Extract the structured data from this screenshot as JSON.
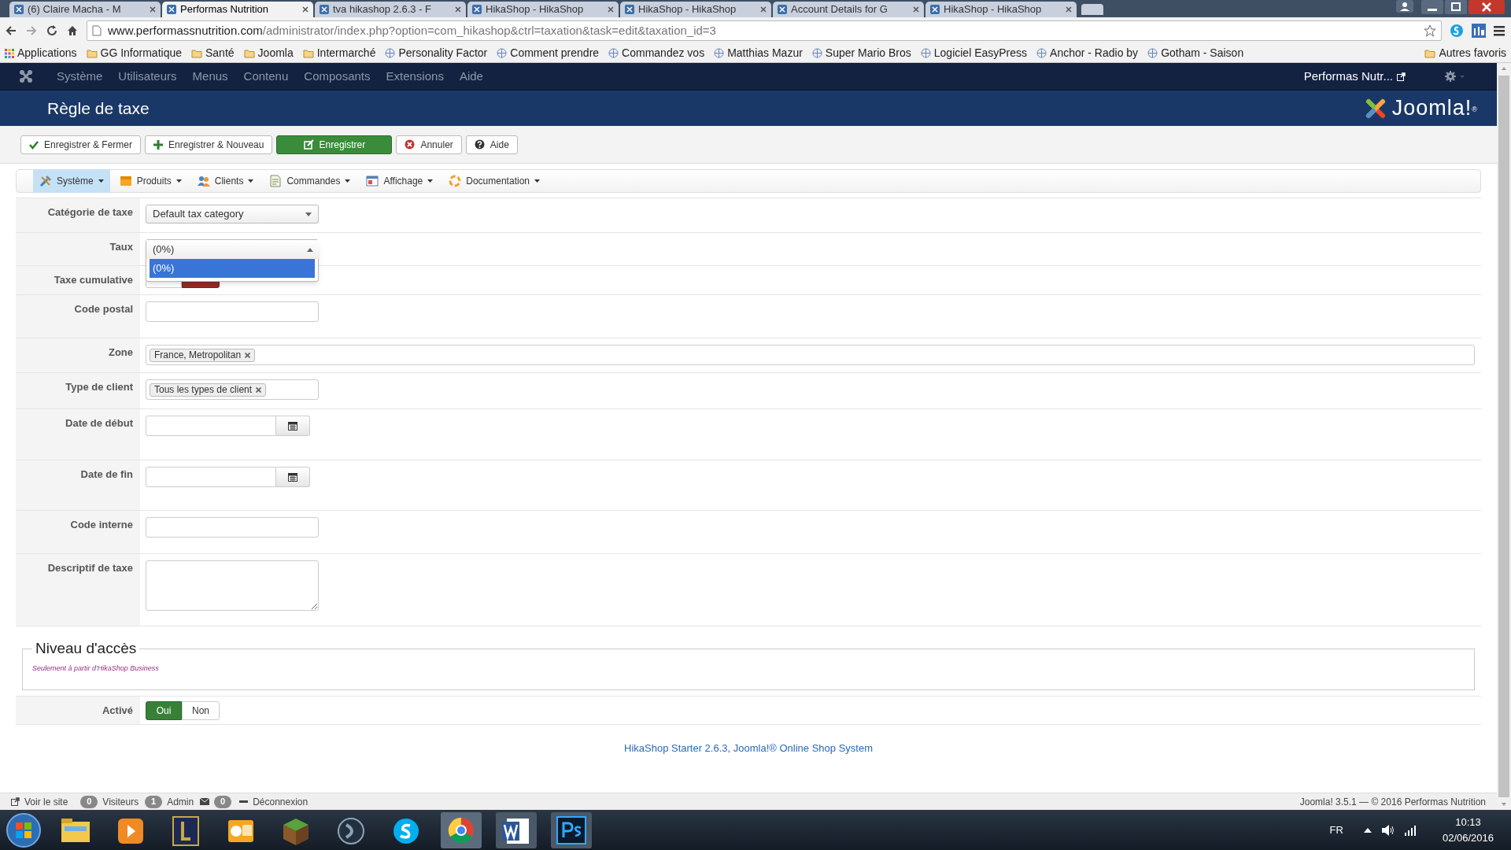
{
  "browser": {
    "tabs": [
      {
        "label": "(6) Claire Macha - M",
        "selected": false
      },
      {
        "label": "Performas Nutrition",
        "selected": true
      },
      {
        "label": "tva hikashop 2.6.3 - F",
        "selected": false
      },
      {
        "label": "HikaShop - HikaShop",
        "selected": false
      },
      {
        "label": "HikaShop - HikaShop",
        "selected": false
      },
      {
        "label": "Account Details for G",
        "selected": false
      },
      {
        "label": "HikaShop - HikaShop",
        "selected": false
      }
    ],
    "url_host": "www.performassnutrition.com",
    "url_path": "/administrator/index.php?option=com_hikashop&ctrl=taxation&task=edit&taxation_id=3",
    "bookmarks": [
      {
        "label": "Applications",
        "kind": "apps"
      },
      {
        "label": "GG Informatique",
        "kind": "folder"
      },
      {
        "label": "Santé",
        "kind": "folder"
      },
      {
        "label": "Joomla",
        "kind": "folder"
      },
      {
        "label": "Intermarché",
        "kind": "folder"
      },
      {
        "label": "Personality Factor",
        "kind": "site"
      },
      {
        "label": "Comment prendre",
        "kind": "site"
      },
      {
        "label": "Commandez vos",
        "kind": "site"
      },
      {
        "label": "Matthias Mazur",
        "kind": "site"
      },
      {
        "label": "Super Mario Bros",
        "kind": "site"
      },
      {
        "label": "Logiciel EasyPress",
        "kind": "site"
      },
      {
        "label": "Anchor - Radio by",
        "kind": "site"
      },
      {
        "label": "Gotham - Saison",
        "kind": "site"
      }
    ],
    "other_bookmarks": "Autres favoris"
  },
  "admin_menu": {
    "items": [
      "Système",
      "Utilisateurs",
      "Menus",
      "Contenu",
      "Composants",
      "Extensions",
      "Aide"
    ],
    "site_link": "Performas Nutr..."
  },
  "page": {
    "title": "Règle de taxe",
    "logo_text": "Joomla!$^{®}$"
  },
  "toolbar": [
    {
      "label": "Enregistrer & Fermer",
      "kind": "check",
      "primary": false
    },
    {
      "label": "Enregistrer & Nouveau",
      "kind": "plus",
      "primary": false
    },
    {
      "label": "Enregistrer",
      "kind": "edit",
      "primary": true
    },
    {
      "label": "Annuler",
      "kind": "cancel",
      "primary": false
    },
    {
      "label": "Aide",
      "kind": "help",
      "primary": false
    }
  ],
  "submenu": [
    {
      "label": "Système",
      "kind": "tools",
      "selected": true
    },
    {
      "label": "Produits",
      "kind": "box",
      "selected": false
    },
    {
      "label": "Clients",
      "kind": "users",
      "selected": false
    },
    {
      "label": "Commandes",
      "kind": "orders",
      "selected": false
    },
    {
      "label": "Affichage",
      "kind": "display",
      "selected": false
    },
    {
      "label": "Documentation",
      "kind": "docs",
      "selected": false
    }
  ],
  "form": [
    {
      "label": "Catégorie de taxe",
      "kind": "select",
      "value": "Default tax category"
    },
    {
      "label": "Taux",
      "kind": "select_open",
      "value": "(0%)",
      "options": [
        {
          "label": "(0%)",
          "selected": true
        }
      ]
    },
    {
      "label": "Taxe cumulative",
      "kind": "toggle",
      "options": [
        {
          "selected": false
        },
        {
          "selected": true
        }
      ]
    },
    {
      "label": "Code postal",
      "kind": "text"
    },
    {
      "label": "Zone",
      "kind": "tags",
      "wide": true,
      "tags": [
        "France, Metropolitan"
      ]
    },
    {
      "label": "Type de client",
      "kind": "tags",
      "wide": false,
      "tags": [
        "Tous les types de client"
      ]
    },
    {
      "label": "Date de début",
      "kind": "date"
    },
    {
      "label": "Date de fin",
      "kind": "date"
    },
    {
      "label": "Code interne",
      "kind": "text"
    },
    {
      "label": "Descriptif de taxe",
      "kind": "textarea"
    }
  ],
  "access": {
    "legend": "Niveau d'accès",
    "note": "Seulement à partir d'HikaShop Business"
  },
  "active": {
    "label": "Activé",
    "options": [
      {
        "label": "Oui",
        "selected": true
      },
      {
        "label": "Non",
        "selected": false
      }
    ]
  },
  "footer_link": "HikaShop Starter 2.6.3, Joomla!® Online Shop System",
  "status_bar": {
    "items": [
      {
        "kind": "link",
        "label": "Voir le site"
      },
      {
        "kind": "count",
        "count": "0",
        "label": "Visiteurs"
      },
      {
        "kind": "count",
        "count": "1",
        "label": "Admin"
      },
      {
        "kind": "mail",
        "count": "0"
      },
      {
        "kind": "logout",
        "label": "Déconnexion"
      }
    ],
    "right": "Joomla! 3.5.1 — © 2016 Performas Nutrition"
  },
  "taskbar": {
    "language": "FR",
    "time": "10:13",
    "date": "02/06/2016"
  }
}
